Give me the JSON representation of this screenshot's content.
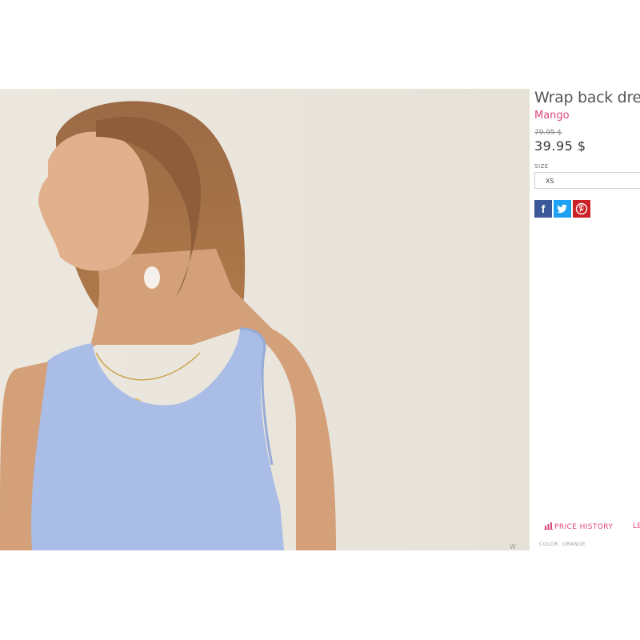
{
  "product": {
    "title": "Wrap back dress",
    "brand": "Mango",
    "original_price": "79.95 $",
    "price": "39.95 $",
    "size_label": "SIZE",
    "size_selected": "XS"
  },
  "share": {
    "facebook": "f",
    "twitter": "twitter-icon",
    "pinterest": "pinterest-icon"
  },
  "links": {
    "price_history": "PRICE HISTORY",
    "cut_off": "LE"
  },
  "color_line": "COLOR: ORANGE",
  "image": {
    "watermark": "W"
  },
  "colors": {
    "accent": "#e0457b",
    "facebook": "#3b5998",
    "twitter": "#1da1f2",
    "pinterest": "#cb2027"
  }
}
